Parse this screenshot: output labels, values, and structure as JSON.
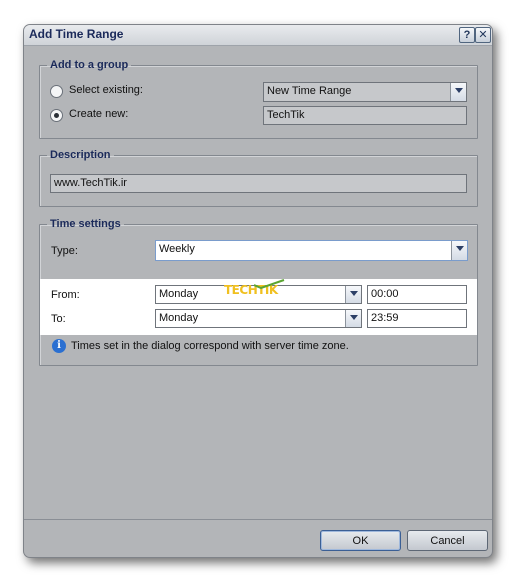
{
  "dialog": {
    "title": "Add Time Range",
    "help_label": "?",
    "close_label": "✕",
    "ok_label": "OK",
    "cancel_label": "Cancel"
  },
  "group_section": {
    "legend": "Add to a group",
    "select_existing_label": "Select existing:",
    "select_existing_value": "New Time Range",
    "create_new_label": "Create new:",
    "create_new_value": "TechTik",
    "selected_option": "create_new"
  },
  "description_section": {
    "legend": "Description",
    "value": "www.TechTik.ir"
  },
  "time_settings": {
    "legend": "Time settings",
    "type_label": "Type:",
    "type_value": "Weekly",
    "from_label": "From:",
    "from_day": "Monday",
    "from_time": "00:00",
    "to_label": "To:",
    "to_day": "Monday",
    "to_time": "23:59",
    "info_text": "Times set in the dialog correspond with server time zone."
  },
  "watermark": {
    "text": "TECHTIK"
  },
  "icons": {
    "info": "info-icon",
    "dropdown": "chevron-down-icon"
  }
}
